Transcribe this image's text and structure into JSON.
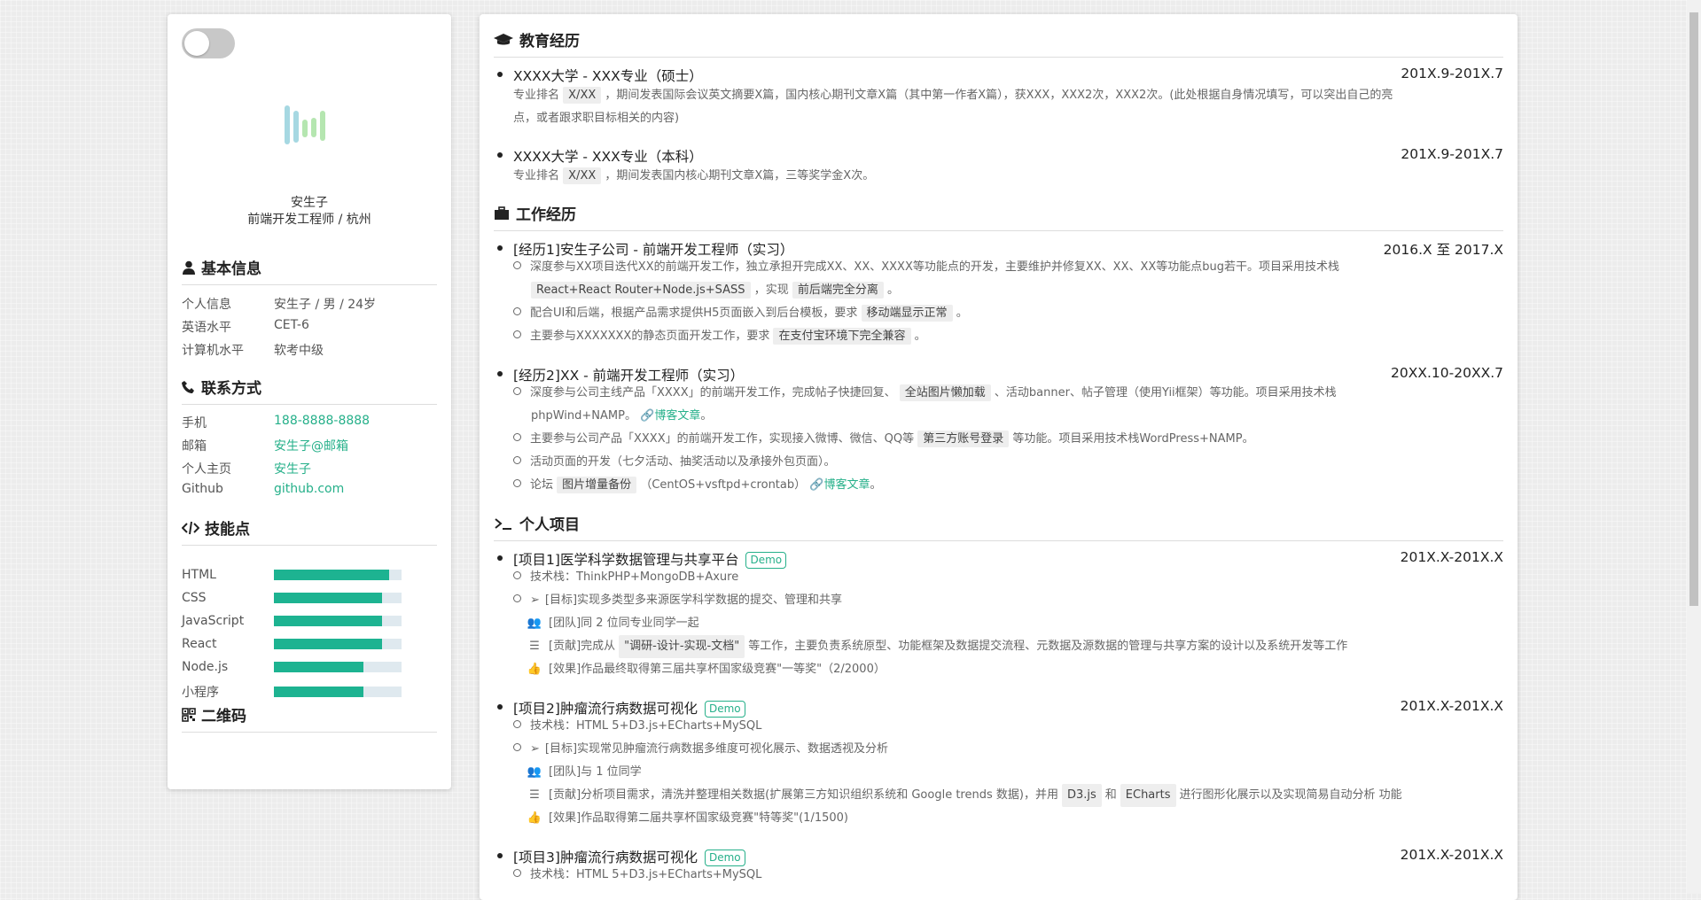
{
  "profile": {
    "name": "安生子",
    "title": "前端开发工程师 / 杭州"
  },
  "basic": {
    "heading": "基本信息",
    "rows": [
      {
        "k": "个人信息",
        "v": "安生子 / 男 / 24岁"
      },
      {
        "k": "英语水平",
        "v": "CET-6"
      },
      {
        "k": "计算机水平",
        "v": "软考中级"
      }
    ]
  },
  "contact": {
    "heading": "联系方式",
    "rows": [
      {
        "k": "手机",
        "v": "188-8888-8888"
      },
      {
        "k": "邮箱",
        "v": "安生子@邮箱"
      },
      {
        "k": "个人主页",
        "v": "安生子"
      },
      {
        "k": "Github",
        "v": "github.com"
      }
    ]
  },
  "skills": {
    "heading": "技能点",
    "items": [
      {
        "name": "HTML",
        "level": 0.9
      },
      {
        "name": "CSS",
        "level": 0.85
      },
      {
        "name": "JavaScript",
        "level": 0.85
      },
      {
        "name": "React",
        "level": 0.85
      },
      {
        "name": "Node.js",
        "level": 0.7
      },
      {
        "name": "小程序",
        "level": 0.7
      }
    ]
  },
  "qr": {
    "heading": "二维码"
  },
  "education": {
    "heading": "教育经历",
    "items": [
      {
        "title": "XXXX大学 - XXX专业（硕士）",
        "date": "201X.9-201X.7",
        "pre": "专业排名",
        "rank": "X/XX",
        "text1": "，期间发表国际会议英文摘要X篇，国内核心期刊文章X篇（其中第一作者X篇），获XXX，XXX2次，XXX2次。(此处根据自身情况填写，可以突出自己的亮",
        "text2": "点，或者跟求职目标相关的内容)"
      },
      {
        "title": "XXXX大学 - XXX专业（本科）",
        "date": "201X.9-201X.7",
        "pre": "专业排名",
        "rank": "X/XX",
        "text1": "，期间发表国内核心期刊文章X篇，三等奖学金X次。"
      }
    ]
  },
  "work": {
    "heading": "工作经历",
    "j1": {
      "title": "[经历1]安生子公司 - 前端开发工程师（实习）",
      "date": "2016.X 至 2017.X",
      "s1a": "深度参与XX项目迭代XX的前端开发工作，独立承担开完成XX、XX、XXXX等功能点的开发，主要维护并修复XX、XX、XX等功能点bug若干。项目采用技术栈",
      "s1b": "React+React Router+Node.js+SASS",
      "s1c": "，实现",
      "s1d": "前后端完全分离",
      "s1e": "。",
      "s2a": "配合UI和后端，根据产品需求提供H5页面嵌入到后台模板，要求",
      "s2b": "移动端显示正常",
      "s2c": "。",
      "s3a": "主要参与XXXXXXX的静态页面开发工作，要求",
      "s3b": "在支付宝环境下完全兼容",
      "s3c": "。"
    },
    "j2": {
      "title": "[经历2]XX - 前端开发工程师（实习）",
      "date": "20XX.10-20XX.7",
      "s1a": "深度参与公司主线产品「XXXX」的前端开发工作，完成帖子快捷回复、",
      "s1b": "全站图片懒加载",
      "s1c": "、活动banner、帖子管理（使用Yii框架）等功能。项目采用技术栈",
      "s1d": "phpWind+NAMP。",
      "s1e": "博客文章",
      "s1f": "。",
      "s2a": "主要参与公司产品「XXXX」的前端开发工作，实现接入微博、微信、QQ等",
      "s2b": "第三方账号登录",
      "s2c": "等功能。项目采用技术栈WordPress+NAMP。",
      "s3": "活动页面的开发（七夕活动、抽奖活动以及承接外包页面）。",
      "s4a": "论坛",
      "s4b": "图片增量备份",
      "s4c": "（CentOS+vsftpd+crontab）",
      "s4d": "博客文章",
      "s4e": "。"
    }
  },
  "projects": {
    "heading": "个人项目",
    "demo": "Demo",
    "p1": {
      "title": "[项目1]医学科学数据管理与共享平台",
      "date": "201X.X-201X.X",
      "stack": "技术栈：ThinkPHP+MongoDB+Axure",
      "goal": "[目标]实现多类型多来源医学科学数据的提交、管理和共享",
      "team": "[团队]同 2 位同专业同学一起",
      "contrib_a": "[贡献]完成从",
      "contrib_b": "\"调研-设计-实现-文档\"",
      "contrib_c": "等工作，主要负责系统原型、功能框架及数据提交流程、元数据及源数据的管理与共享方案的设计以及系统开发等工作",
      "effect": "[效果]作品最终取得第三届共享杯国家级竞赛\"一等奖\"（2/2000）"
    },
    "p2": {
      "title": "[项目2]肿瘤流行病数据可视化",
      "date": "201X.X-201X.X",
      "stack": "技术栈：HTML 5+D3.js+ECharts+MySQL",
      "goal": "[目标]实现常见肿瘤流行病数据多维度可视化展示、数据透视及分析",
      "team": "[团队]与 1 位同学",
      "contrib_a": "[贡献]分析项目需求，清洗并整理相关数据(扩展第三方知识组织系统和 Google trends 数据)，并用",
      "contrib_b": "D3.js",
      "contrib_c": "和",
      "contrib_d": "ECharts",
      "contrib_e": "进行图形化展示以及实现简易自动分析 功能",
      "effect": "[效果]作品取得第二届共享杯国家级竞赛\"特等奖\"(1/1500)"
    },
    "p3": {
      "title": "[项目3]肿瘤流行病数据可视化",
      "date": "201X.X-201X.X",
      "stack": "技术栈：HTML 5+D3.js+ECharts+MySQL"
    }
  }
}
